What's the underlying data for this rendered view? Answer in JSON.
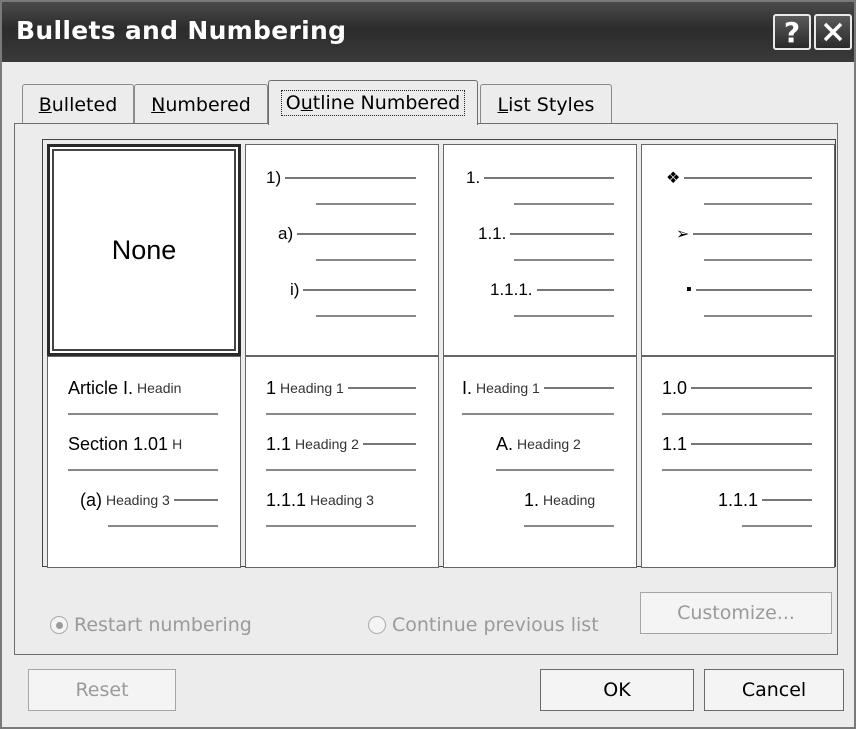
{
  "window": {
    "title": "Bullets and Numbering",
    "help_glyph": "?",
    "close_glyph": "✕"
  },
  "tabs": [
    {
      "label_acc": "B",
      "label_rest": "ulleted"
    },
    {
      "label_acc": "N",
      "label_rest": "umbered"
    },
    {
      "label_pre": "O",
      "label_acc": "u",
      "label_rest": "tline Numbered"
    },
    {
      "label_acc": "L",
      "label_rest": "ist Styles"
    }
  ],
  "gallery": {
    "none_label": "None",
    "styles": [
      {
        "rows": [
          {
            "main": "1)"
          },
          {
            "main": "a)"
          },
          {
            "main": "i)"
          }
        ]
      },
      {
        "rows": [
          {
            "main": "1."
          },
          {
            "main": "1.1."
          },
          {
            "main": "1.1.1."
          }
        ]
      },
      {
        "rows": [
          {
            "icon": "diamond-bullet-icon",
            "glyph": "❖"
          },
          {
            "icon": "arrow-bullet-icon",
            "glyph": "➢"
          },
          {
            "icon": "square-bullet-icon",
            "glyph": "▪"
          }
        ]
      },
      {
        "rows": [
          {
            "main": "Article I.",
            "sub": "Headin"
          },
          {
            "main": "Section 1.01",
            "sub": "H"
          },
          {
            "main": "(a)",
            "sub": "Heading 3"
          }
        ]
      },
      {
        "rows": [
          {
            "main": "1",
            "sub": "Heading 1"
          },
          {
            "main": "1.1",
            "sub": "Heading 2"
          },
          {
            "main": "1.1.1",
            "sub": "Heading 3"
          }
        ]
      },
      {
        "rows": [
          {
            "main": "I.",
            "sub": "Heading 1"
          },
          {
            "main": "A.",
            "sub": "Heading 2"
          },
          {
            "main": "1.",
            "sub": "Heading"
          }
        ]
      },
      {
        "rows": [
          {
            "main": "1.0"
          },
          {
            "main": "1.1"
          },
          {
            "main": "1.1.1"
          }
        ]
      }
    ]
  },
  "options": {
    "restart_label": "Restart numbering",
    "continue_label": "Continue previous list",
    "customize_label": "Customize..."
  },
  "buttons": {
    "reset": "Reset",
    "ok": "OK",
    "cancel": "Cancel"
  }
}
